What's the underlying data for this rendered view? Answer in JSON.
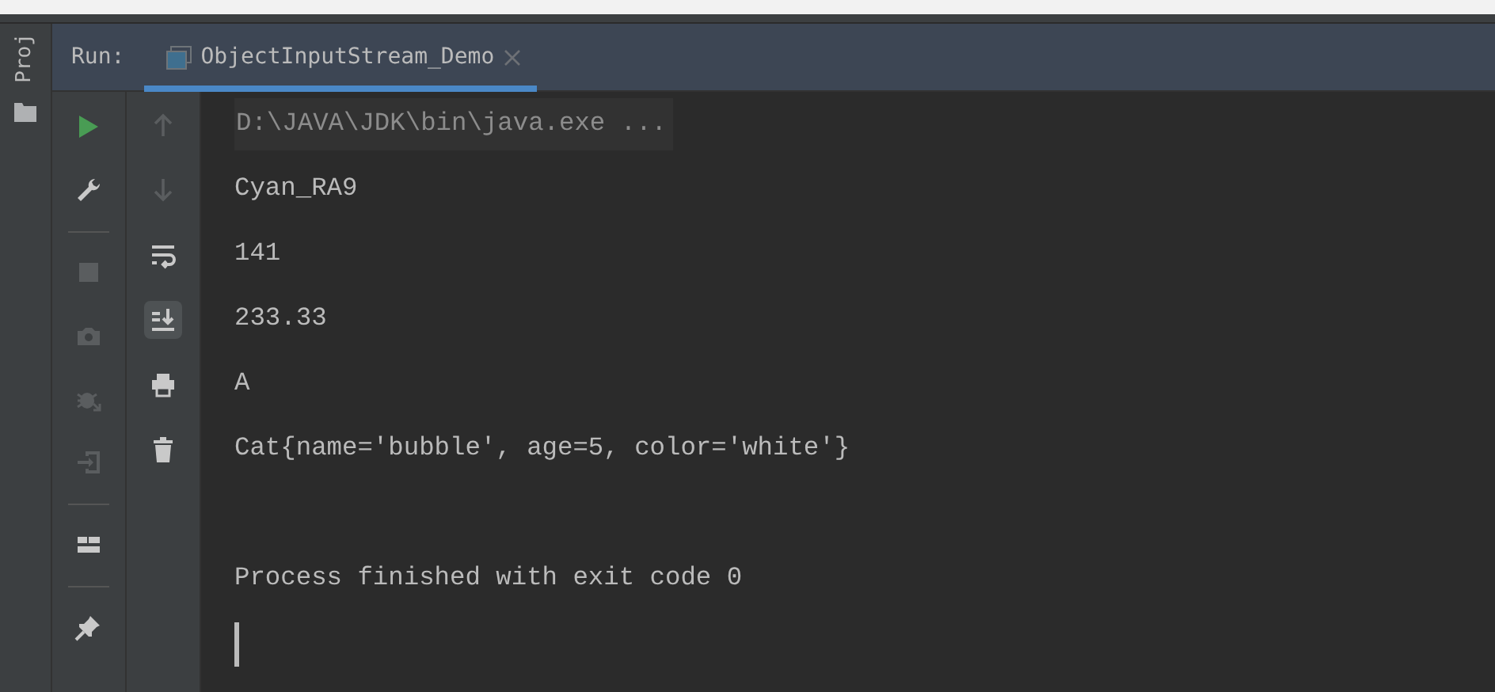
{
  "side_strip": {
    "label": "Proj"
  },
  "run_header": {
    "label": "Run:",
    "tabs": [
      {
        "title": "ObjectInputStream_Demo",
        "selected": true
      }
    ]
  },
  "toolbar_left": [
    {
      "kind": "run",
      "disabled": false
    },
    {
      "kind": "wrench",
      "disabled": false
    },
    {
      "kind": "separator"
    },
    {
      "kind": "stop",
      "disabled": true
    },
    {
      "kind": "camera",
      "disabled": true
    },
    {
      "kind": "bug",
      "disabled": true
    },
    {
      "kind": "exit",
      "disabled": true
    },
    {
      "kind": "separator"
    },
    {
      "kind": "layout",
      "disabled": false
    },
    {
      "kind": "separator"
    },
    {
      "kind": "pin",
      "disabled": false
    }
  ],
  "toolbar_right": [
    {
      "kind": "up",
      "disabled": true
    },
    {
      "kind": "down",
      "disabled": true
    },
    {
      "kind": "wrap",
      "disabled": false,
      "selected": false
    },
    {
      "kind": "scroll-end",
      "disabled": false,
      "selected": true
    },
    {
      "kind": "print",
      "disabled": false
    },
    {
      "kind": "trash",
      "disabled": false
    }
  ],
  "console": {
    "lines": [
      {
        "kind": "command",
        "text": "D:\\JAVA\\JDK\\bin\\java.exe ..."
      },
      {
        "kind": "output",
        "text": "Cyan_RA9"
      },
      {
        "kind": "output",
        "text": "141"
      },
      {
        "kind": "output",
        "text": "233.33"
      },
      {
        "kind": "output",
        "text": "A"
      },
      {
        "kind": "output",
        "text": "Cat{name='bubble', age=5, color='white'}"
      },
      {
        "kind": "blank"
      },
      {
        "kind": "status",
        "text": "Process finished with exit code 0"
      }
    ],
    "cursor": true
  }
}
